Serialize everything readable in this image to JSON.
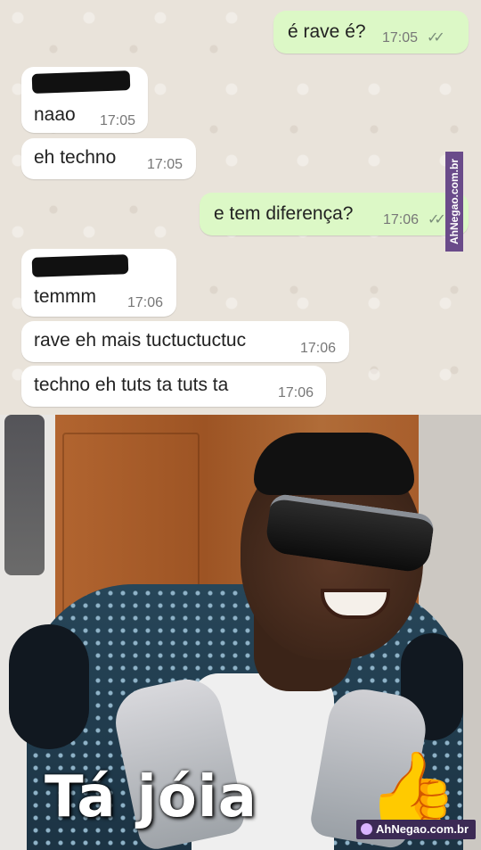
{
  "chat": {
    "messages": [
      {
        "direction": "outgoing",
        "text": "é rave é?",
        "time": "17:05",
        "ticks": "✓✓"
      },
      {
        "direction": "incoming",
        "sender_redacted": true,
        "text": "naao",
        "time": "17:05"
      },
      {
        "direction": "incoming",
        "text": "eh techno",
        "time": "17:05"
      },
      {
        "direction": "outgoing",
        "text": "e tem diferença?",
        "time": "17:06",
        "ticks": "✓✓"
      },
      {
        "direction": "incoming",
        "sender_redacted": true,
        "text": "temmm",
        "time": "17:06"
      },
      {
        "direction": "incoming",
        "text": "rave eh mais tuctuctuctuc",
        "time": "17:06"
      },
      {
        "direction": "incoming",
        "text": "techno eh tuts ta tuts ta",
        "time": "17:06"
      }
    ],
    "colors": {
      "outgoing_bubble": "#dcf8c6",
      "incoming_bubble": "#ffffff",
      "background": "#e9e3da"
    }
  },
  "watermarks": {
    "side": "AhNegao.com.br",
    "corner": "AhNegao.com.br"
  },
  "meme": {
    "caption": "Tá jóia",
    "emoji": "👍"
  }
}
